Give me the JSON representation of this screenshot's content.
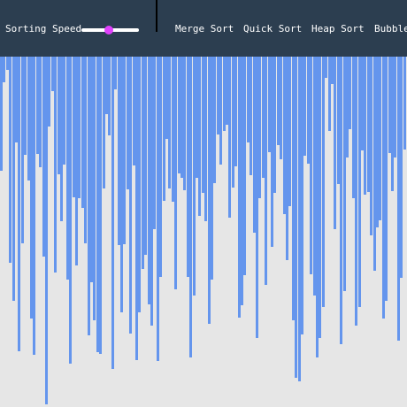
{
  "toolbar": {
    "speed_label": "Sorting Speed",
    "speed_value": 0.48,
    "algorithms": [
      "Merge Sort",
      "Quick Sort",
      "Heap Sort",
      "Bubble"
    ]
  },
  "colors": {
    "bar": "#6495ed",
    "header_bg": "#2c3e50",
    "slider_thumb": "#e040fb",
    "background": "#e6e6e6"
  },
  "array_values": [
    129,
    29,
    15,
    233,
    276,
    97,
    333,
    211,
    111,
    140,
    296,
    337,
    110,
    125,
    226,
    393,
    79,
    39,
    244,
    133,
    186,
    122,
    252,
    347,
    159,
    236,
    160,
    171,
    211,
    315,
    255,
    298,
    334,
    336,
    149,
    65,
    89,
    353,
    37,
    213,
    289,
    212,
    150,
    313,
    123,
    343,
    289,
    240,
    224,
    280,
    304,
    195,
    344,
    249,
    163,
    93,
    149,
    164,
    263,
    132,
    137,
    151,
    249,
    340,
    270,
    137,
    180,
    154,
    186,
    302,
    252,
    143,
    88,
    122,
    84,
    77,
    182,
    148,
    124,
    295,
    281,
    247,
    97,
    134,
    199,
    318,
    160,
    137,
    258,
    108,
    215,
    154,
    100,
    116,
    178,
    230,
    169,
    298,
    363,
    367,
    314,
    112,
    121,
    246,
    270,
    340,
    318,
    283,
    24,
    84,
    31,
    195,
    144,
    325,
    265,
    114,
    82,
    160,
    304,
    283,
    106,
    156,
    153,
    202,
    242,
    193,
    185,
    296,
    276,
    109,
    152,
    114,
    321,
    250,
    105
  ]
}
